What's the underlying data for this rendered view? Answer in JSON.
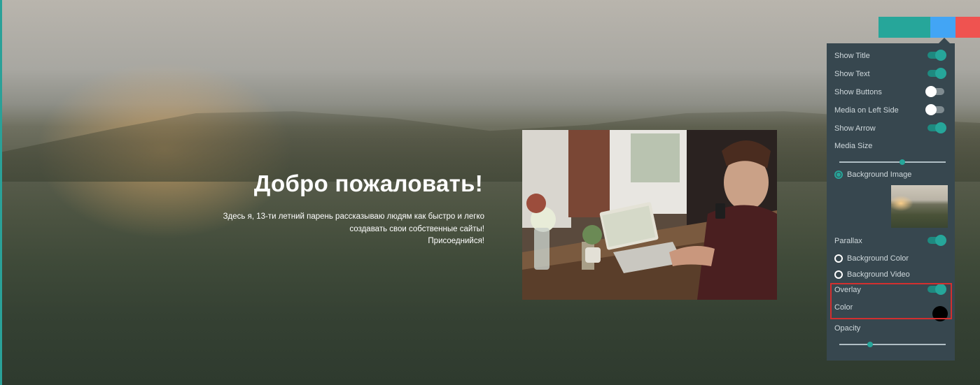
{
  "hero": {
    "title": "Добро пожаловать!",
    "text_lines": [
      "Здесь я, 13-ти летний парень рассказываю людям как быстро и легко",
      "создавать свои собственные сайты!",
      "Присоеднийся!"
    ]
  },
  "panel": {
    "tab_colors": [
      "#26a69a",
      "#42a5f5",
      "#ef5350"
    ],
    "show_title": {
      "label": "Show Title",
      "on": true
    },
    "show_text": {
      "label": "Show Text",
      "on": true
    },
    "show_buttons": {
      "label": "Show Buttons",
      "on": false
    },
    "media_left": {
      "label": "Media on Left Side",
      "on": false
    },
    "show_arrow": {
      "label": "Show Arrow",
      "on": true
    },
    "media_size": {
      "label": "Media Size",
      "value_pct": 58
    },
    "background_image": {
      "label": "Background Image",
      "selected": true
    },
    "parallax": {
      "label": "Parallax",
      "on": true
    },
    "background_color": {
      "label": "Background Color",
      "selected": false
    },
    "background_video": {
      "label": "Background Video",
      "selected": false
    },
    "overlay": {
      "label": "Overlay",
      "on": true
    },
    "color": {
      "label": "Color",
      "value": "#000000"
    },
    "opacity": {
      "label": "Opacity",
      "value_pct": 28
    }
  }
}
